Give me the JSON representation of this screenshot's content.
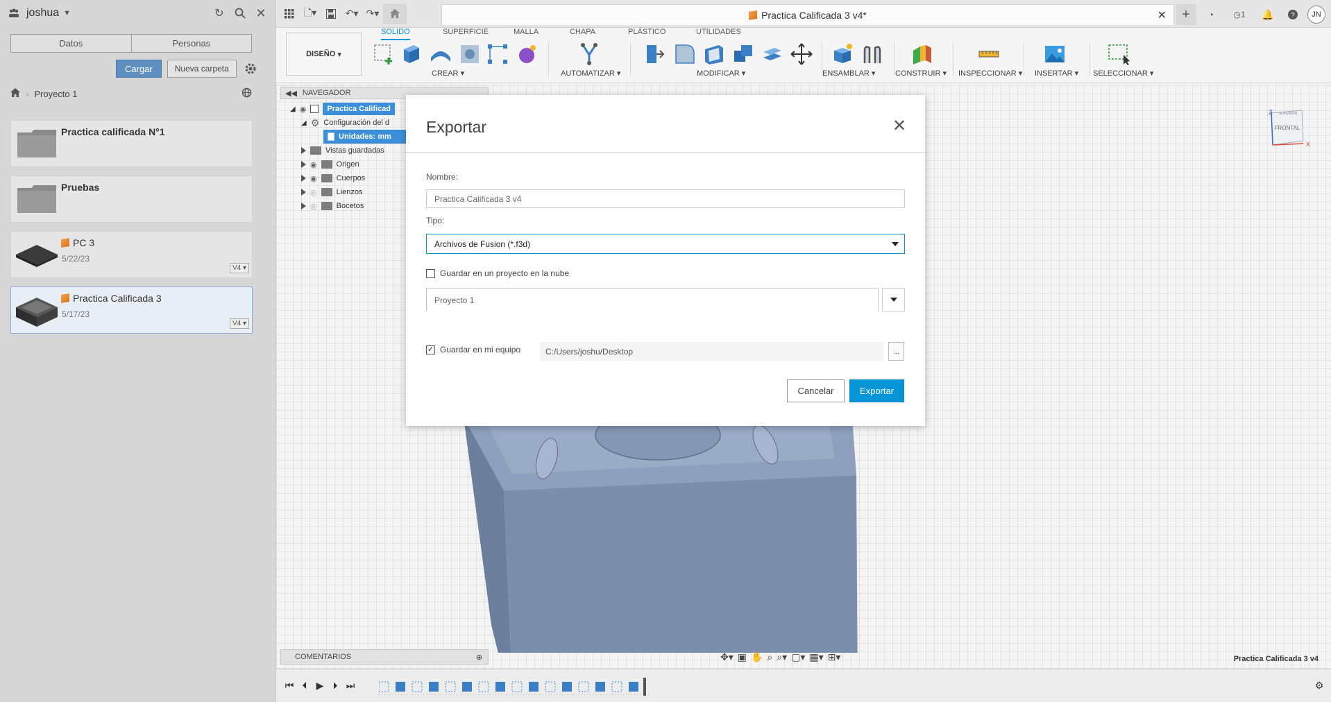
{
  "left_panel": {
    "user": "joshua",
    "tabs": [
      "Datos",
      "Personas"
    ],
    "upload_label": "Cargar",
    "new_folder_label": "Nueva carpeta",
    "breadcrumb_project": "Proyecto 1",
    "items": [
      {
        "title": "Practica calificada N°1",
        "date": "",
        "version": "",
        "kind": "folder"
      },
      {
        "title": "Pruebas",
        "date": "",
        "version": "",
        "kind": "folder"
      },
      {
        "title": "PC 3",
        "date": "5/22/23",
        "version": "V4",
        "kind": "design"
      },
      {
        "title": "Practica Calificada 3",
        "date": "5/17/23",
        "version": "V4",
        "kind": "design"
      }
    ]
  },
  "document": {
    "tab_title": "Practica Calificada 3 v4*",
    "status_name": "Practica Calificada 3 v4",
    "job_count": "1",
    "user_initials": "JN"
  },
  "ribbon": {
    "workspace": "DISEÑO",
    "tabs": [
      "SOLIDO",
      "SUPERFICIE",
      "MALLA",
      "CHAPA",
      "PLÁSTICO",
      "UTILIDADES"
    ],
    "active_tab": "SOLIDO",
    "groups": [
      "CREAR",
      "AUTOMATIZAR",
      "MODIFICAR",
      "ENSAMBLAR",
      "CONSTRUIR",
      "INSPECCIONAR",
      "INSERTAR",
      "SELECCIONAR"
    ]
  },
  "navigator": {
    "title": "NAVEGADOR",
    "root": "Practica Calificad",
    "config": "Configuración del d",
    "units": "Unidades: mm",
    "rows": [
      "Vistas guardadas",
      "Origen",
      "Cuerpos",
      "Lienzos",
      "Bocetos"
    ]
  },
  "viewcube": {
    "face_front": "FRONTAL",
    "face_top": "SUPERIOR",
    "axis_x": "X",
    "axis_z": "Z"
  },
  "comments_label": "COMENTARIOS",
  "export_dialog": {
    "title": "Exportar",
    "name_label": "Nombre:",
    "name_value": "Practica Calificada 3 v4",
    "type_label": "Tipo:",
    "type_value": "Archivos de Fusion (*.f3d)",
    "cloud_label": "Guardar en un proyecto en la nube",
    "cloud_checked": false,
    "cloud_project": "Proyecto 1",
    "local_label": "Guardar en mi equipo",
    "local_checked": true,
    "local_path": "C:/Users/joshu/Desktop",
    "browse_label": "...",
    "cancel_label": "Cancelar",
    "export_label": "Exportar"
  },
  "colors": {
    "accent": "#0696d7",
    "upload_btn": "#5f8fbe",
    "model": "#7b8fad",
    "selection": "#3a8fd8"
  }
}
